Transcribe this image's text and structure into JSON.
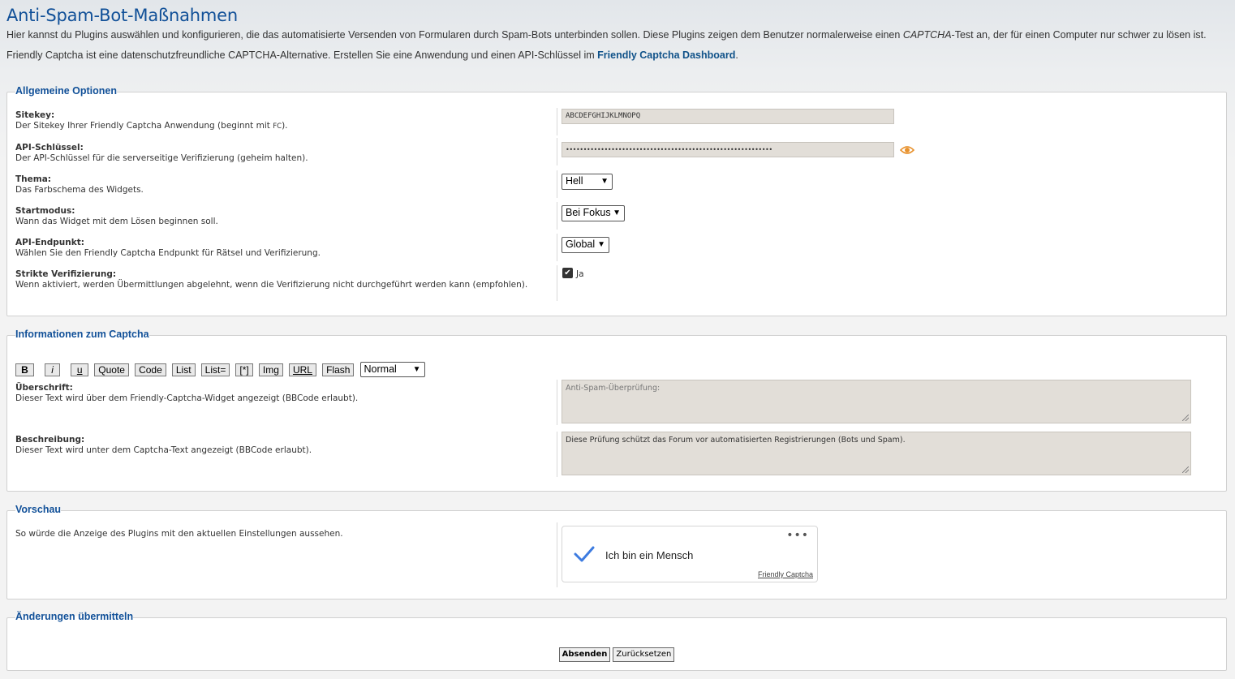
{
  "page": {
    "title": "Anti-Spam-Bot-Maßnahmen",
    "intro_1_pre": "Hier kannst du Plugins auswählen und konfigurieren, die das automatisierte Versenden von Formularen durch Spam-Bots unterbinden sollen. Diese Plugins zeigen dem Benutzer normalerweise einen ",
    "intro_1_em": "CAPTCHA",
    "intro_1_post": "-Test an, der für einen Computer nur schwer zu lösen ist.",
    "intro_2_pre": "Friendly Captcha ist eine datenschutzfreundliche CAPTCHA-Alternative. Erstellen Sie eine Anwendung und einen API-Schlüssel im ",
    "intro_2_link": "Friendly Captcha Dashboard",
    "intro_2_post": "."
  },
  "general": {
    "legend": "Allgemeine Optionen",
    "sitekey": {
      "label": "Sitekey:",
      "desc_pre": "Der Sitekey Ihrer Friendly Captcha Anwendung (beginnt mit ",
      "desc_code": "FC",
      "desc_post": ").",
      "value": "ABCDEFGHIJKLMNOPQ"
    },
    "apikey": {
      "label": "API-Schlüssel:",
      "desc": "Der API-Schlüssel für die serverseitige Verifizierung (geheim halten).",
      "value": "•••••••••••••••••••••••••••••••••••••••••••••••••••••••••••",
      "reveal_icon": "eye-icon"
    },
    "theme": {
      "label": "Thema:",
      "desc": "Das Farbschema des Widgets.",
      "selected": "Hell"
    },
    "start": {
      "label": "Startmodus:",
      "desc": "Wann das Widget mit dem Lösen beginnen soll.",
      "selected": "Bei Fokus"
    },
    "endpoint": {
      "label": "API-Endpunkt:",
      "desc": "Wählen Sie den Friendly Captcha Endpunkt für Rätsel und Verifizierung.",
      "selected": "Global"
    },
    "strict": {
      "label": "Strikte Verifizierung:",
      "desc": "Wenn aktiviert, werden Übermittlungen abgelehnt, wenn die Verifizierung nicht durchgeführt werden kann (empfohlen).",
      "checkbox_label": "Ja",
      "checked": true
    }
  },
  "info": {
    "legend": "Informationen zum Captcha",
    "bbcode_buttons": [
      "B",
      "i",
      "u",
      "Quote",
      "Code",
      "List",
      "List=",
      "[*]",
      "Img",
      "URL",
      "Flash"
    ],
    "font_size_selected": "Normal",
    "heading": {
      "label": "Überschrift:",
      "desc": "Dieser Text wird über dem Friendly-Captcha-Widget angezeigt (BBCode erlaubt).",
      "placeholder": "Anti-Spam-Überprüfung:"
    },
    "description": {
      "label": "Beschreibung:",
      "desc": "Dieser Text wird unter dem Captcha-Text angezeigt (BBCode erlaubt).",
      "value": "Diese Prüfung schützt das Forum vor automatisierten Registrierungen (Bots und Spam)."
    }
  },
  "preview": {
    "legend": "Vorschau",
    "desc": "So würde die Anzeige des Plugins mit den aktuellen Einstellungen aussehen.",
    "widget_text": "Ich bin ein Mensch",
    "widget_brand": "Friendly Captcha",
    "menu_icon": "more-dots-icon",
    "check_icon": "checkmark-icon",
    "accent": "#3d7be0"
  },
  "submit": {
    "legend": "Änderungen übermitteln",
    "submit_label": "Absenden",
    "reset_label": "Zurücksetzen"
  }
}
